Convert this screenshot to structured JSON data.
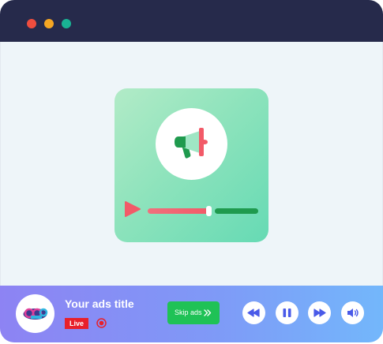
{
  "colors": {
    "titlebar": "#262a4b",
    "window_bg": "#eef5f9",
    "dot_red": "#ef4d3e",
    "dot_yellow": "#f5a623",
    "dot_green": "#19b394",
    "accent_blue": "#4a5ae8",
    "live_red": "#e8202a",
    "skip_green": "#1fc256"
  },
  "icons": {
    "megaphone": "megaphone-icon",
    "play": "play-icon",
    "logo": "channel-logo",
    "record": "record-icon",
    "skip": "double-chevron-right-icon",
    "rewind": "rewind-icon",
    "pause": "pause-icon",
    "forward": "fast-forward-icon",
    "volume": "volume-icon"
  },
  "player": {
    "progress": 0.58
  },
  "ad_bar": {
    "title": "Your ads title",
    "live_label": "Live",
    "skip_label": "Skip ads"
  }
}
